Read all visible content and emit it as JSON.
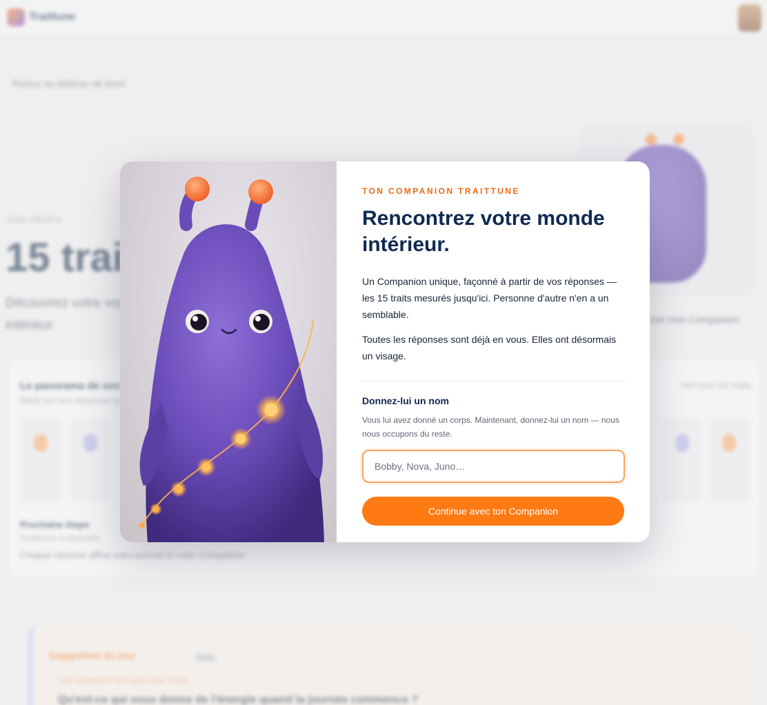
{
  "background": {
    "logo_text": "Traittune",
    "back_link": "Retour au tableau de bord",
    "eyebrow": "TON PROFIL",
    "big_title": "15 traits",
    "intro": "Découvrez votre voyage intérieur",
    "meet_link": "Voir mon Companion",
    "traits_heading": "Le panorama de vos traits",
    "traits_sub": "Basé sur vos réponses jusqu'ici",
    "traits_right": "Voir tous les traits",
    "traits_foot1": "Prochaine étape",
    "traits_foot2": "Continuez à répondre",
    "traits_foot3": "Chaque réponse affine votre portrait et votre Companion.",
    "suggest_title": "Suggestion du jour",
    "suggest_badge": "New",
    "suggest_sub": "Une question rien que pour vous",
    "suggest_text": "Qu'est-ce qui vous donne de l'énergie quand la journée commence ?"
  },
  "modal": {
    "eyebrow": "TON COMPANION TRAITTUNE",
    "title": "Rencontrez votre monde intérieur.",
    "para1": "Un Companion unique, façonné à partir de vos réponses — les 15 traits mesurés jusqu'ici. Personne d'autre n'en a un semblable.",
    "para2": "Toutes les réponses sont déjà en vous. Elles ont désormais un visage.",
    "name_label": "Donnez-lui un nom",
    "name_help": "Vous lui avez donné un corps. Maintenant, donnez-lui un nom — nous nous occupons du reste.",
    "name_placeholder": "Bobby, Nova, Juno…",
    "name_value": "",
    "cta_label": "Continue avec ton Companion"
  },
  "colors": {
    "accent": "#ff7a12",
    "eyebrow": "#f06a10",
    "title": "#0f2a52",
    "creature": "#6a4cb8"
  },
  "icons": {
    "companion_art": "purple-companion-creature"
  }
}
